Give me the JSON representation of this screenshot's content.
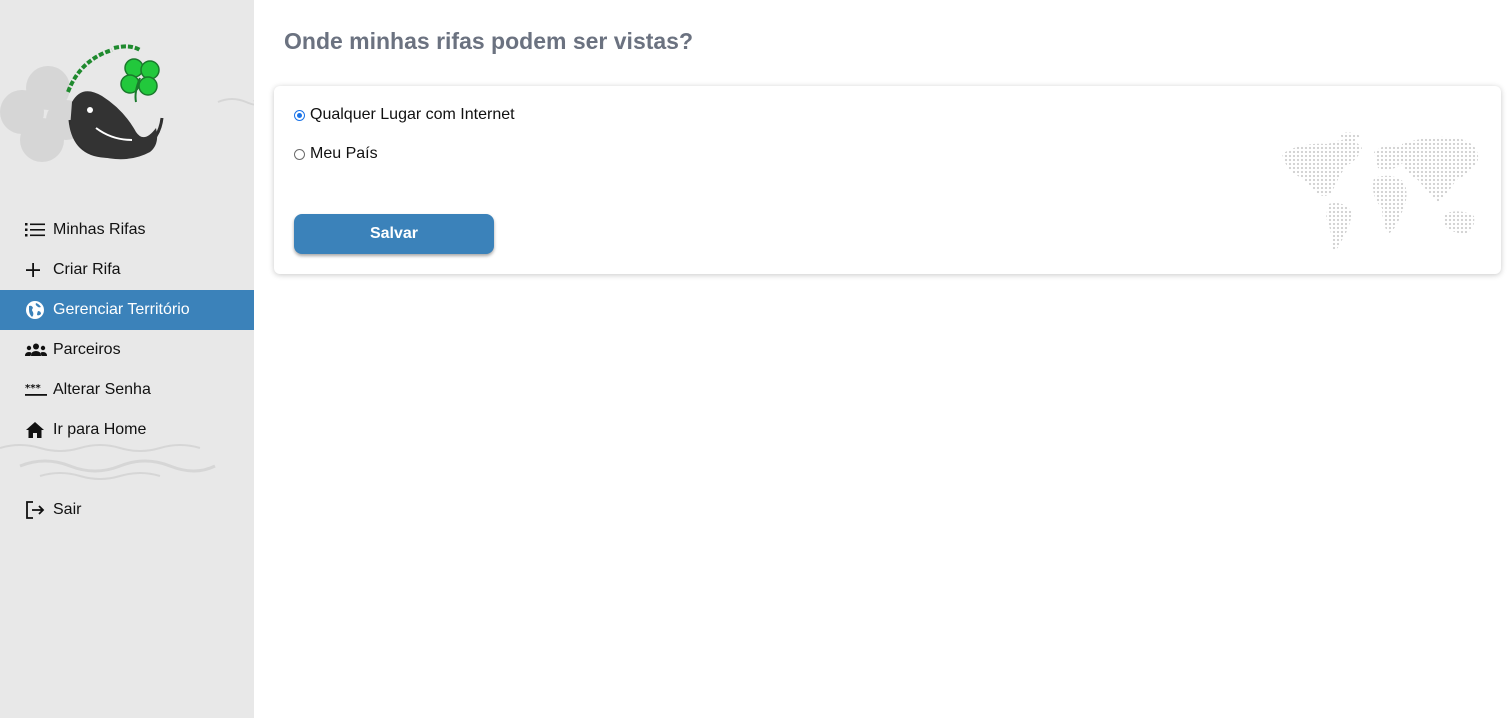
{
  "brand": {
    "name": "LUCKY WHALE"
  },
  "sidebar": {
    "items": [
      {
        "label": "Minhas Rifas",
        "icon": "list-icon",
        "active": false
      },
      {
        "label": "Criar Rifa",
        "icon": "plus-icon",
        "active": false
      },
      {
        "label": "Gerenciar Território",
        "icon": "globe-icon",
        "active": true
      },
      {
        "label": "Parceiros",
        "icon": "group-icon",
        "active": false
      },
      {
        "label": "Alterar Senha",
        "icon": "password-icon",
        "active": false
      },
      {
        "label": "Ir para Home",
        "icon": "home-icon",
        "active": false
      }
    ],
    "logout": {
      "label": "Sair",
      "icon": "logout-icon"
    }
  },
  "main": {
    "title": "Onde minhas rifas podem ser vistas?",
    "options": [
      {
        "label": "Qualquer Lugar com Internet",
        "checked": true
      },
      {
        "label": "Meu País",
        "checked": false
      }
    ],
    "save_label": "Salvar"
  },
  "colors": {
    "accent": "#3b82ba",
    "sidebar_bg": "#e8e8e8",
    "title": "#6b7280",
    "radio_checked": "#1a73e8"
  }
}
